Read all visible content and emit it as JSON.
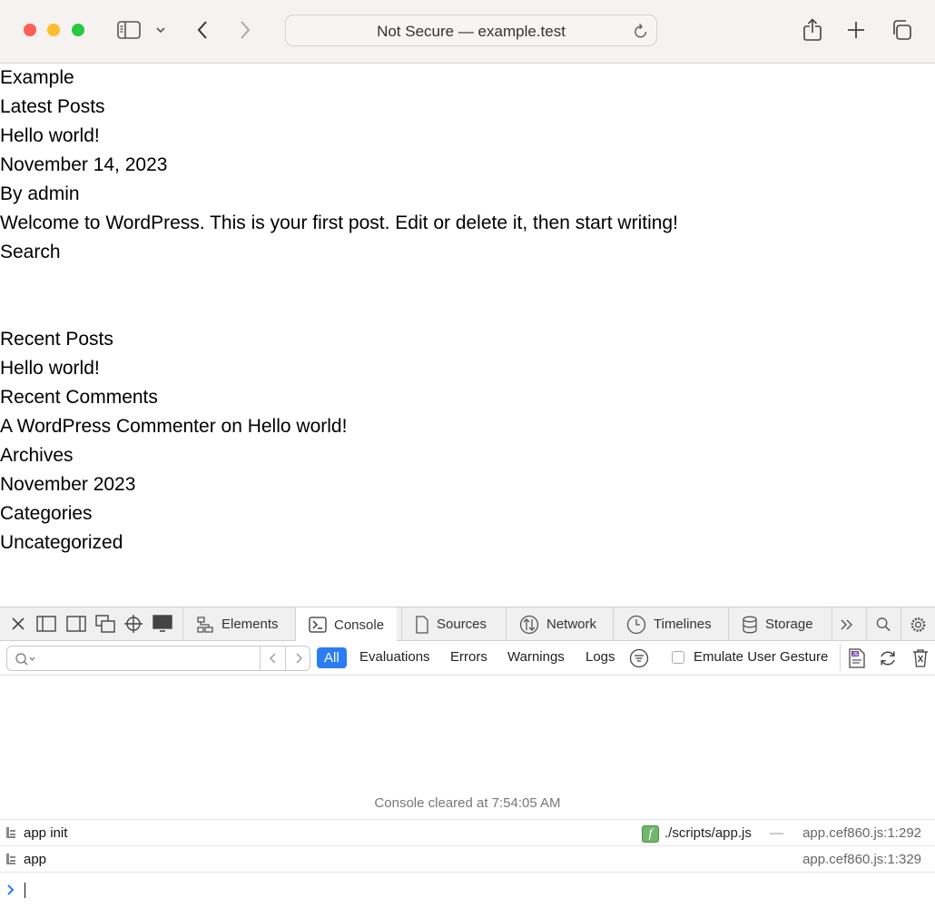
{
  "browser": {
    "address": "Not Secure — example.test"
  },
  "page": {
    "lines": [
      "Example",
      "Latest Posts",
      "Hello world!",
      "November 14, 2023",
      "By admin",
      "Welcome to WordPress. This is your first post. Edit or delete it, then start writing!",
      "Search",
      "Recent Posts",
      "Hello world!",
      "Recent Comments",
      "A WordPress Commenter on Hello world!",
      "Archives",
      "November 2023",
      "Categories",
      "Uncategorized"
    ]
  },
  "devtools": {
    "tabs": [
      "Elements",
      "Console",
      "Sources",
      "Network",
      "Timelines",
      "Storage"
    ],
    "active_tab": "Console",
    "filters": [
      "All",
      "Evaluations",
      "Errors",
      "Warnings",
      "Logs"
    ],
    "emulate_label": "Emulate User Gesture",
    "cleared_message": "Console cleared at 7:54:05 AM",
    "logs": [
      {
        "text": "app init",
        "file": "./scripts/app.js",
        "location": "app.cef860.js:1:292"
      },
      {
        "text": "app",
        "location": "app.cef860.js:1:329"
      }
    ],
    "accent_color": "#2a7df5"
  }
}
